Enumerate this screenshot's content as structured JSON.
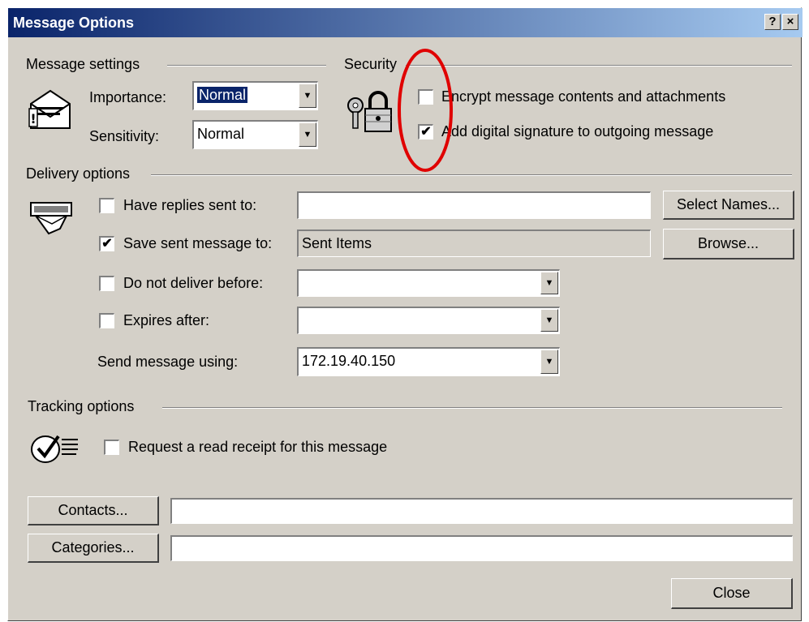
{
  "window": {
    "title": "Message Options",
    "help_label": "?",
    "close_label": "×"
  },
  "message_settings": {
    "group_label": "Message settings",
    "importance_label": "Importance:",
    "importance_value": "Normal",
    "sensitivity_label": "Sensitivity:",
    "sensitivity_value": "Normal"
  },
  "security": {
    "group_label": "Security",
    "encrypt_label": "Encrypt message contents and attachments",
    "encrypt_checked": false,
    "sign_label": "Add digital signature to outgoing message",
    "sign_checked": true
  },
  "delivery": {
    "group_label": "Delivery options",
    "replies_label": "Have replies sent to:",
    "replies_checked": false,
    "replies_value": "",
    "select_names_label": "Select Names...",
    "save_sent_label": "Save sent message to:",
    "save_sent_checked": true,
    "save_sent_value": "Sent Items",
    "browse_label": "Browse...",
    "deliver_before_label": "Do not deliver before:",
    "deliver_before_checked": false,
    "deliver_before_value": "",
    "expires_label": "Expires after:",
    "expires_checked": false,
    "expires_value": "",
    "send_using_label": "Send message using:",
    "send_using_value": "172.19.40.150"
  },
  "tracking": {
    "group_label": "Tracking options",
    "read_receipt_label": "Request a read receipt for this message",
    "read_receipt_checked": false
  },
  "footer": {
    "contacts_label": "Contacts...",
    "contacts_value": "",
    "categories_label": "Categories...",
    "categories_value": "",
    "close_label": "Close"
  },
  "annotation": {
    "color": "#e00000"
  },
  "colors": {
    "titlebar_start": "#0a246a",
    "titlebar_end": "#a6caf0",
    "dialog_bg": "#d4d0c8"
  },
  "check_glyph": "✔"
}
